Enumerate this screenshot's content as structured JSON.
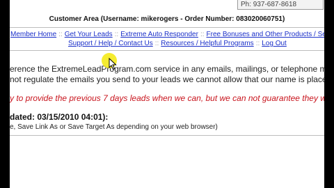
{
  "header": {
    "phone": "Ph: 937-687-8618",
    "customer_area": "Customer Area (Username: mikerogers - Order Number: 083020060751)"
  },
  "nav": {
    "row1": [
      "Member Home",
      "Get Your Leads",
      "Extreme Auto Responder",
      "Free Bonuses and Other Products / Se"
    ],
    "row2": [
      "Support / Help / Contact Us",
      "Resources / Helpful Programs",
      "Log Out"
    ],
    "separator": "::"
  },
  "content": {
    "line1": "erence the ExtremeLeadProgram.com service in any emails, mailings, or telephone me",
    "line2": "not regulate the emails you send to your leads we cannot allow that our name is placed",
    "line3": "y to provide the previous 7 days leads when we can, but we can not guarantee they w",
    "updated": "dated: 03/15/2010 04:01):",
    "instruction": "e, Save Link As or Save Target As depending on your web browser)"
  },
  "colors": {
    "link": "#1a2fc9",
    "warning": "#c8141d",
    "cursor_highlight": "#f4ea1a"
  }
}
